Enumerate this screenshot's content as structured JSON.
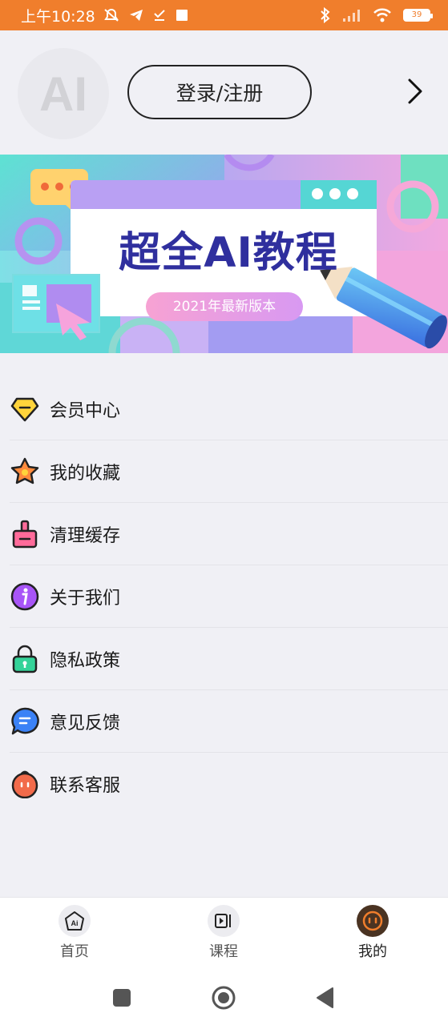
{
  "status_bar": {
    "time": "上午10:28",
    "battery": "39"
  },
  "profile": {
    "avatar_text": "AI",
    "login_label": "登录/注册"
  },
  "banner": {
    "title": "超全AI教程",
    "subtitle": "2021年最新版本"
  },
  "menu": {
    "items": [
      {
        "label": "会员中心",
        "icon": "diamond-icon"
      },
      {
        "label": "我的收藏",
        "icon": "star-icon"
      },
      {
        "label": "清理缓存",
        "icon": "brush-icon"
      },
      {
        "label": "关于我们",
        "icon": "info-icon"
      },
      {
        "label": "隐私政策",
        "icon": "lock-icon"
      },
      {
        "label": "意见反馈",
        "icon": "chat-icon"
      },
      {
        "label": "联系客服",
        "icon": "customer-service-icon"
      }
    ]
  },
  "tabbar": {
    "tabs": [
      {
        "label": "首页",
        "icon": "ai-home-icon"
      },
      {
        "label": "课程",
        "icon": "video-course-icon"
      },
      {
        "label": "我的",
        "icon": "profile-face-icon",
        "active": true
      }
    ]
  },
  "colors": {
    "status_bar": "#f07e2c",
    "active_tab_icon": "#4a3322"
  }
}
